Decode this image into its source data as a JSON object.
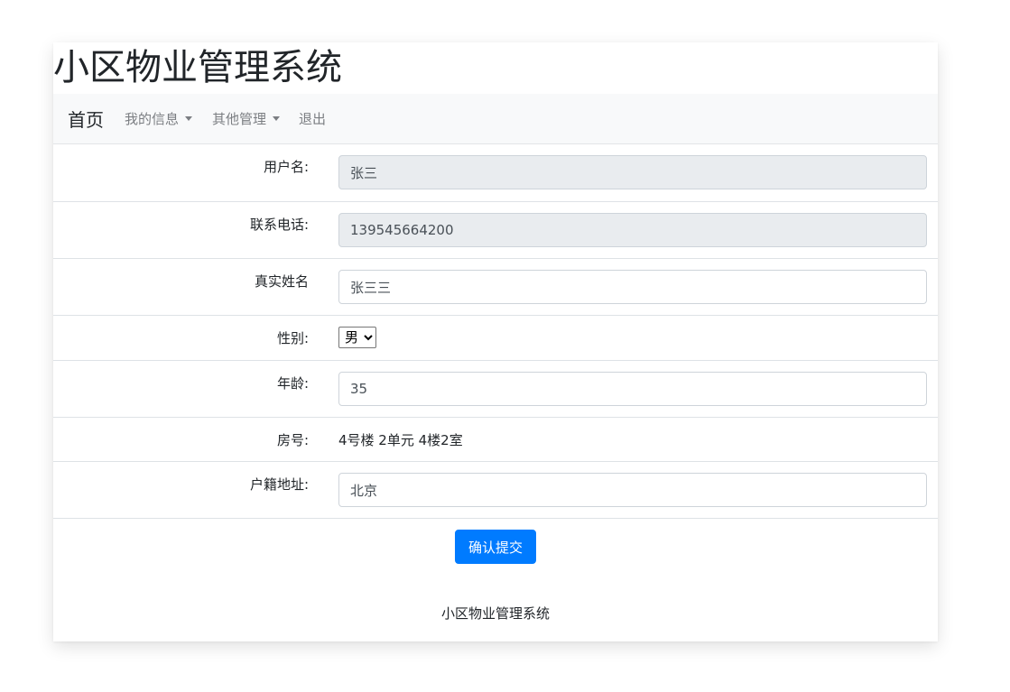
{
  "site_title": "小区物业管理系统",
  "navbar": {
    "brand": "首页",
    "items": [
      {
        "label": "我的信息",
        "dropdown": true
      },
      {
        "label": "其他管理",
        "dropdown": true
      },
      {
        "label": "退出",
        "dropdown": false
      }
    ]
  },
  "form": {
    "username": {
      "label": "用户名:",
      "value": "张三",
      "readonly": true
    },
    "phone": {
      "label": "联系电话:",
      "value": "139545664200",
      "readonly": true
    },
    "real_name": {
      "label": "真实姓名",
      "value": "张三三"
    },
    "gender": {
      "label": "性别:",
      "selected": "男"
    },
    "age": {
      "label": "年龄:",
      "value": "35"
    },
    "room": {
      "label": "房号:",
      "value": "4号楼 2单元 4楼2室"
    },
    "hometown": {
      "label": "户籍地址:",
      "value": "北京"
    },
    "submit_label": "确认提交"
  },
  "footer": {
    "text": "小区物业管理系统"
  },
  "colors": {
    "primary": "#007bff",
    "navbar_bg": "#f8f9fa",
    "readonly_bg": "#e9ecef"
  }
}
